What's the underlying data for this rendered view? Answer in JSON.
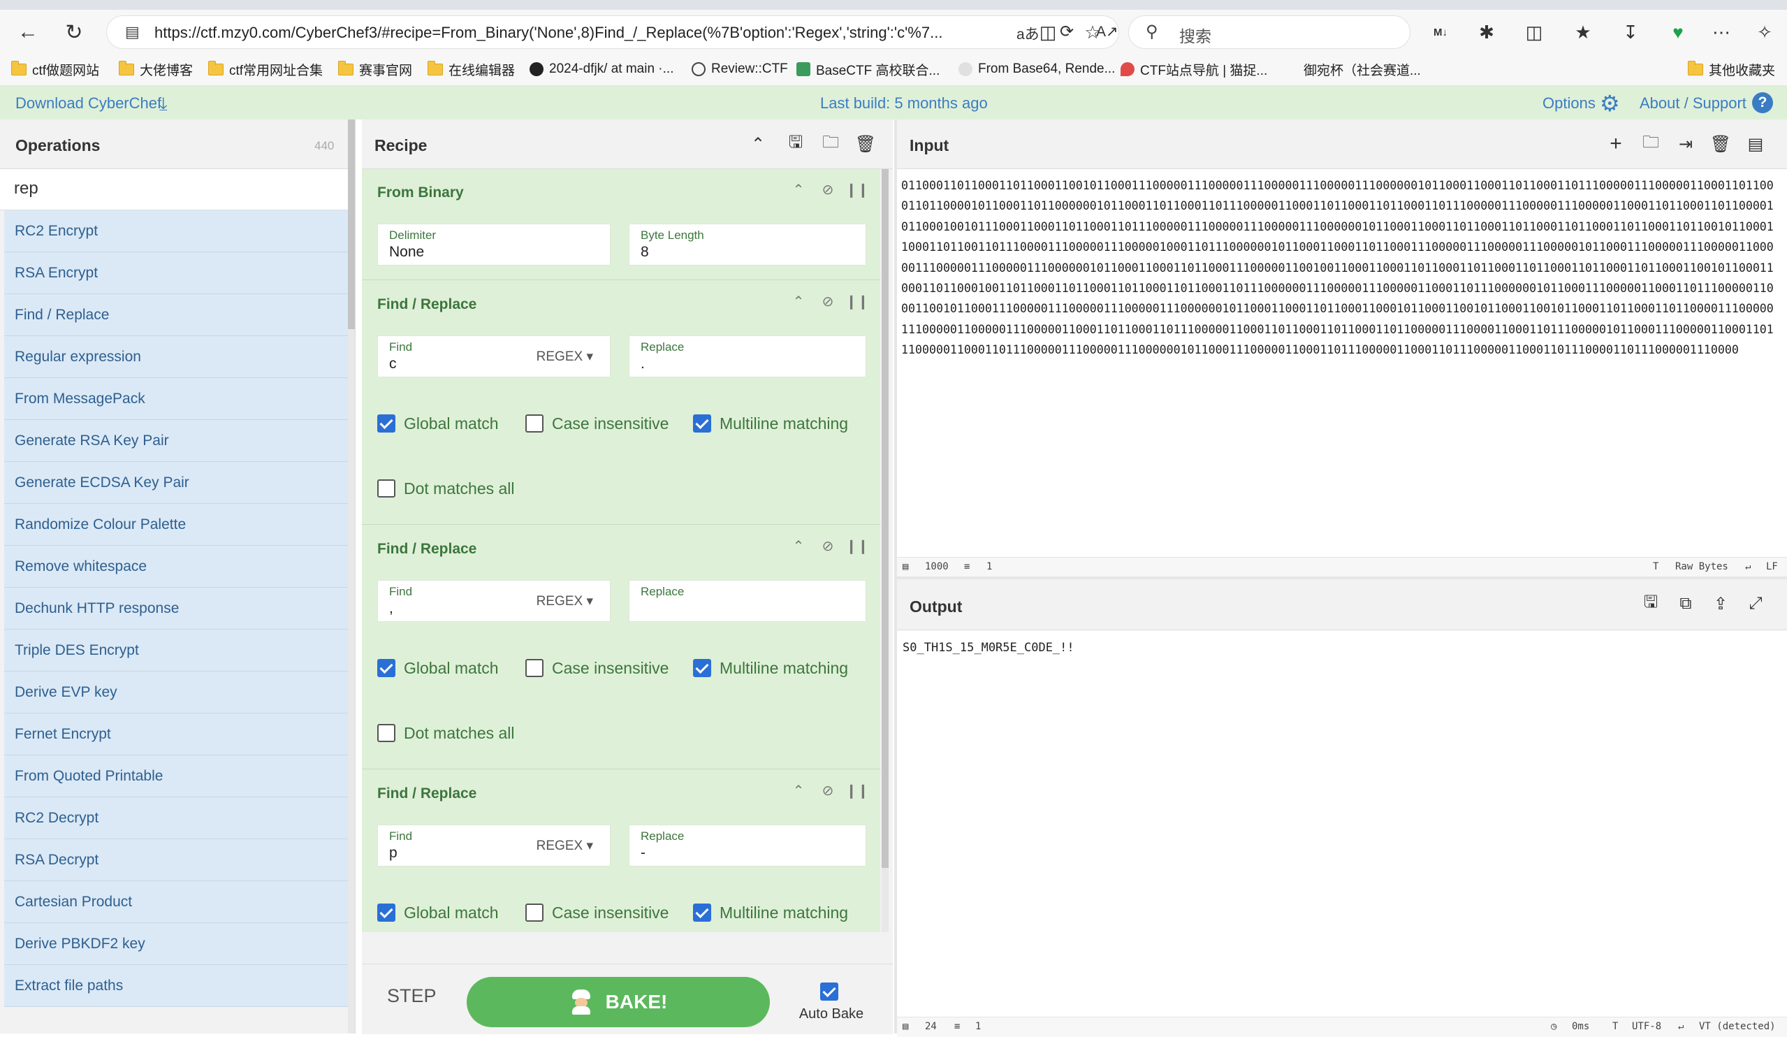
{
  "browser": {
    "url": "https://ctf.mzy0.com/CyberChef3/#recipe=From_Binary('None',8)Find_/_Replace(%7B'option':'Regex','string':'c'%7...",
    "search_placeholder": "搜索"
  },
  "bookmarks": [
    {
      "label": "ctf做题网站",
      "icon": "folder-icon"
    },
    {
      "label": "大佬博客",
      "icon": "folder-icon"
    },
    {
      "label": "ctf常用网址合集",
      "icon": "folder-icon"
    },
    {
      "label": "赛事官网",
      "icon": "folder-icon"
    },
    {
      "label": "在线编辑器",
      "icon": "folder-icon"
    },
    {
      "label": "2024-dfjk/ at main ·...",
      "icon": "github-icon"
    },
    {
      "label": "Review::CTF",
      "icon": "globe-icon"
    },
    {
      "label": "BaseCTF 高校联合...",
      "icon": "site-icon"
    },
    {
      "label": "From Base64, Rende...",
      "icon": "chef-icon"
    },
    {
      "label": "CTF站点导航 | 猫捉...",
      "icon": "heart-icon"
    },
    {
      "label": "御宛杯（社会赛道...",
      "icon": "none"
    },
    {
      "label": "其他收藏夹",
      "icon": "folder-icon"
    }
  ],
  "banner": {
    "download": "Download CyberChef",
    "last_build": "Last build: 5 months ago",
    "options": "Options",
    "about": "About / Support"
  },
  "operations": {
    "title": "Operations",
    "count": "440",
    "search": "rep",
    "items": [
      "RC2 Encrypt",
      "RSA Encrypt",
      "Find / Replace",
      "Regular expression",
      "From MessagePack",
      "Generate RSA Key Pair",
      "Generate ECDSA Key Pair",
      "Randomize Colour Palette",
      "Remove whitespace",
      "Dechunk HTTP response",
      "Triple DES Encrypt",
      "Derive EVP key",
      "Fernet Encrypt",
      "From Quoted Printable",
      "RC2 Decrypt",
      "RSA Decrypt",
      "Cartesian Product",
      "Derive PBKDF2 key",
      "Extract file paths"
    ]
  },
  "recipe": {
    "title": "Recipe",
    "ops": [
      {
        "name": "From Binary",
        "fields": [
          {
            "label": "Delimiter",
            "value": "None"
          },
          {
            "label": "Byte Length",
            "value": "8"
          }
        ]
      },
      {
        "name": "Find / Replace",
        "find_label": "Find",
        "find": "c",
        "mode": "REGEX",
        "replace_label": "Replace",
        "replace": ".",
        "global": "Global match",
        "case": "Case insensitive",
        "multiline": "Multiline matching",
        "dotall": "Dot matches all"
      },
      {
        "name": "Find / Replace",
        "find_label": "Find",
        "find": ",",
        "mode": "REGEX",
        "replace_label": "Replace",
        "replace": "",
        "global": "Global match",
        "case": "Case insensitive",
        "multiline": "Multiline matching",
        "dotall": "Dot matches all"
      },
      {
        "name": "Find / Replace",
        "find_label": "Find",
        "find": "p",
        "mode": "REGEX",
        "replace_label": "Replace",
        "replace": "-",
        "global": "Global match",
        "case": "Case insensitive",
        "multiline": "Multiline matching"
      }
    ],
    "step": "STEP",
    "bake": "BAKE!",
    "autobake": "Auto Bake"
  },
  "input": {
    "title": "Input",
    "text": "0110001101100011011000110010110001110000011100000111000001110000011100000010110001100011011000110111000001110000011000110110001101100001011000110110000001011000110110001101110000011000110110001101100011011100000111000001110000011000110110001101100001011000100101110001100011011000110111000001110000011100000111000000101100011000110110001101100011011000110110001101100101100011000110110011011100001110000011100000100011011100000010110001100011011000111000001110000011100000101100011100000111000001100000111000001110000011100000010110001100011011000111000001100100110001100011011000110110001101100011011000110110001100101100011000110110001001101100011011000110110001101100011011100000011100000111000001100011011100000010110001110000011000110111000001100011001011000111000001110000011100000111000000101100011000110110001100010110001100101100011001011000110110001101100001110000011100000110000011100000110001101100011011100000110001101100011011000110110000011100001100011011100000101100011100000110001101110000011000110111000001110000011100000010110001110000011000110111000001100011011100000110001101110000110111000001110000",
    "stat_len": "1000",
    "stat_lines": "1",
    "stat_mode": "Raw Bytes",
    "stat_eol": "LF"
  },
  "output": {
    "title": "Output",
    "text": "S0_TH1S_15_M0R5E_C0DE_!!",
    "stat_len": "24",
    "stat_lines": "1",
    "stat_time": "0ms",
    "stat_enc": "UTF-8",
    "stat_eol": "VT (detected)"
  },
  "colors": {
    "recipe_bg": "#dff0d8",
    "ops_item_bg": "#dbe9f6",
    "bake_green": "#5cb85c",
    "checkbox_blue": "#2a6fd6"
  }
}
